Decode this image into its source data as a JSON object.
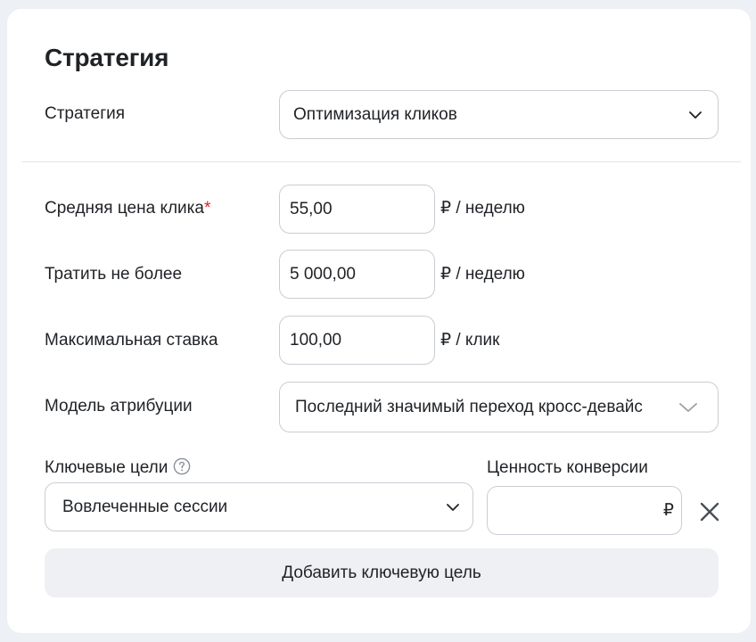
{
  "section": {
    "title": "Стратегия"
  },
  "strategy": {
    "label": "Стратегия",
    "value": "Оптимизация кликов"
  },
  "avg_cpc": {
    "label": "Средняя цена клика",
    "required_mark": "*",
    "value": "55,00",
    "unit": "₽ / неделю"
  },
  "spend_limit": {
    "label": "Тратить не более",
    "value": "5 000,00",
    "unit": "₽ / неделю"
  },
  "max_bid": {
    "label": "Максимальная ставка",
    "value": "100,00",
    "unit": "₽ / клик"
  },
  "attribution": {
    "label": "Модель атрибуции",
    "value": "Последний значимый переход кросс-девайс"
  },
  "key_goals": {
    "label": "Ключевые цели",
    "help_icon": "question-circle-icon",
    "value": "Вовлеченные сессии"
  },
  "conversion_value": {
    "label": "Ценность конверсии",
    "value": "",
    "currency": "₽"
  },
  "remove_icon": "close-icon",
  "add_goal_button": {
    "label": "Добавить ключевую цель"
  },
  "colors": {
    "page_bg": "#edf0f4",
    "card_bg": "#ffffff",
    "border": "#c9cdd3",
    "required": "#e02020",
    "button_bg": "#eef0f3",
    "text": "#1f2226"
  }
}
